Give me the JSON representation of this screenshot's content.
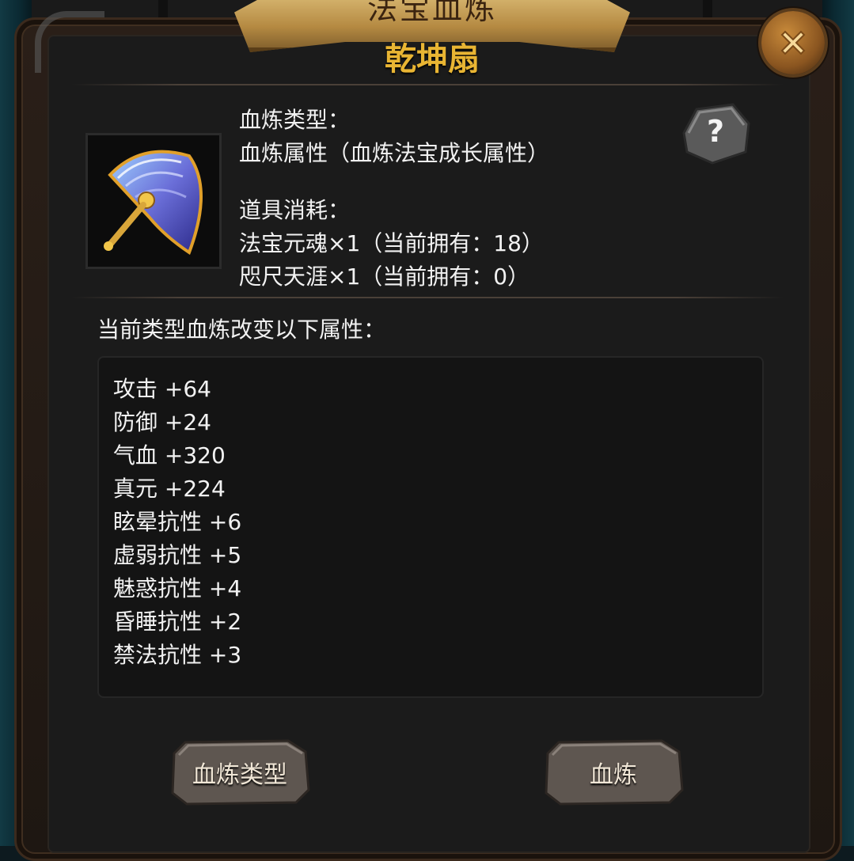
{
  "banner": {
    "title": "法宝血炼",
    "item_name": "乾坤扇"
  },
  "info": {
    "type_label": "血炼类型：",
    "type_value": "血炼属性（血炼法宝成长属性）",
    "cost_label": "道具消耗：",
    "cost_items": [
      "法宝元魂×1（当前拥有：18）",
      "咫尺天涯×1（当前拥有：0）"
    ]
  },
  "help": {
    "label": "?"
  },
  "attributes": {
    "title": "当前类型血炼改变以下属性：",
    "lines": [
      "攻击 +64",
      "防御 +24",
      "气血 +320",
      "真元 +224",
      "眩晕抗性 +6",
      "虚弱抗性 +5",
      "魅惑抗性 +4",
      "昏睡抗性 +2",
      "禁法抗性 +3"
    ]
  },
  "buttons": {
    "type_button": "血炼类型",
    "refine_button": "血炼"
  },
  "colors": {
    "item_name": "#e9b533",
    "text": "#f2f2f2",
    "panel": "#1b1b1b"
  },
  "icons": {
    "close": "close-x-icon",
    "help": "question-stone-icon",
    "item": "fan-icon"
  }
}
